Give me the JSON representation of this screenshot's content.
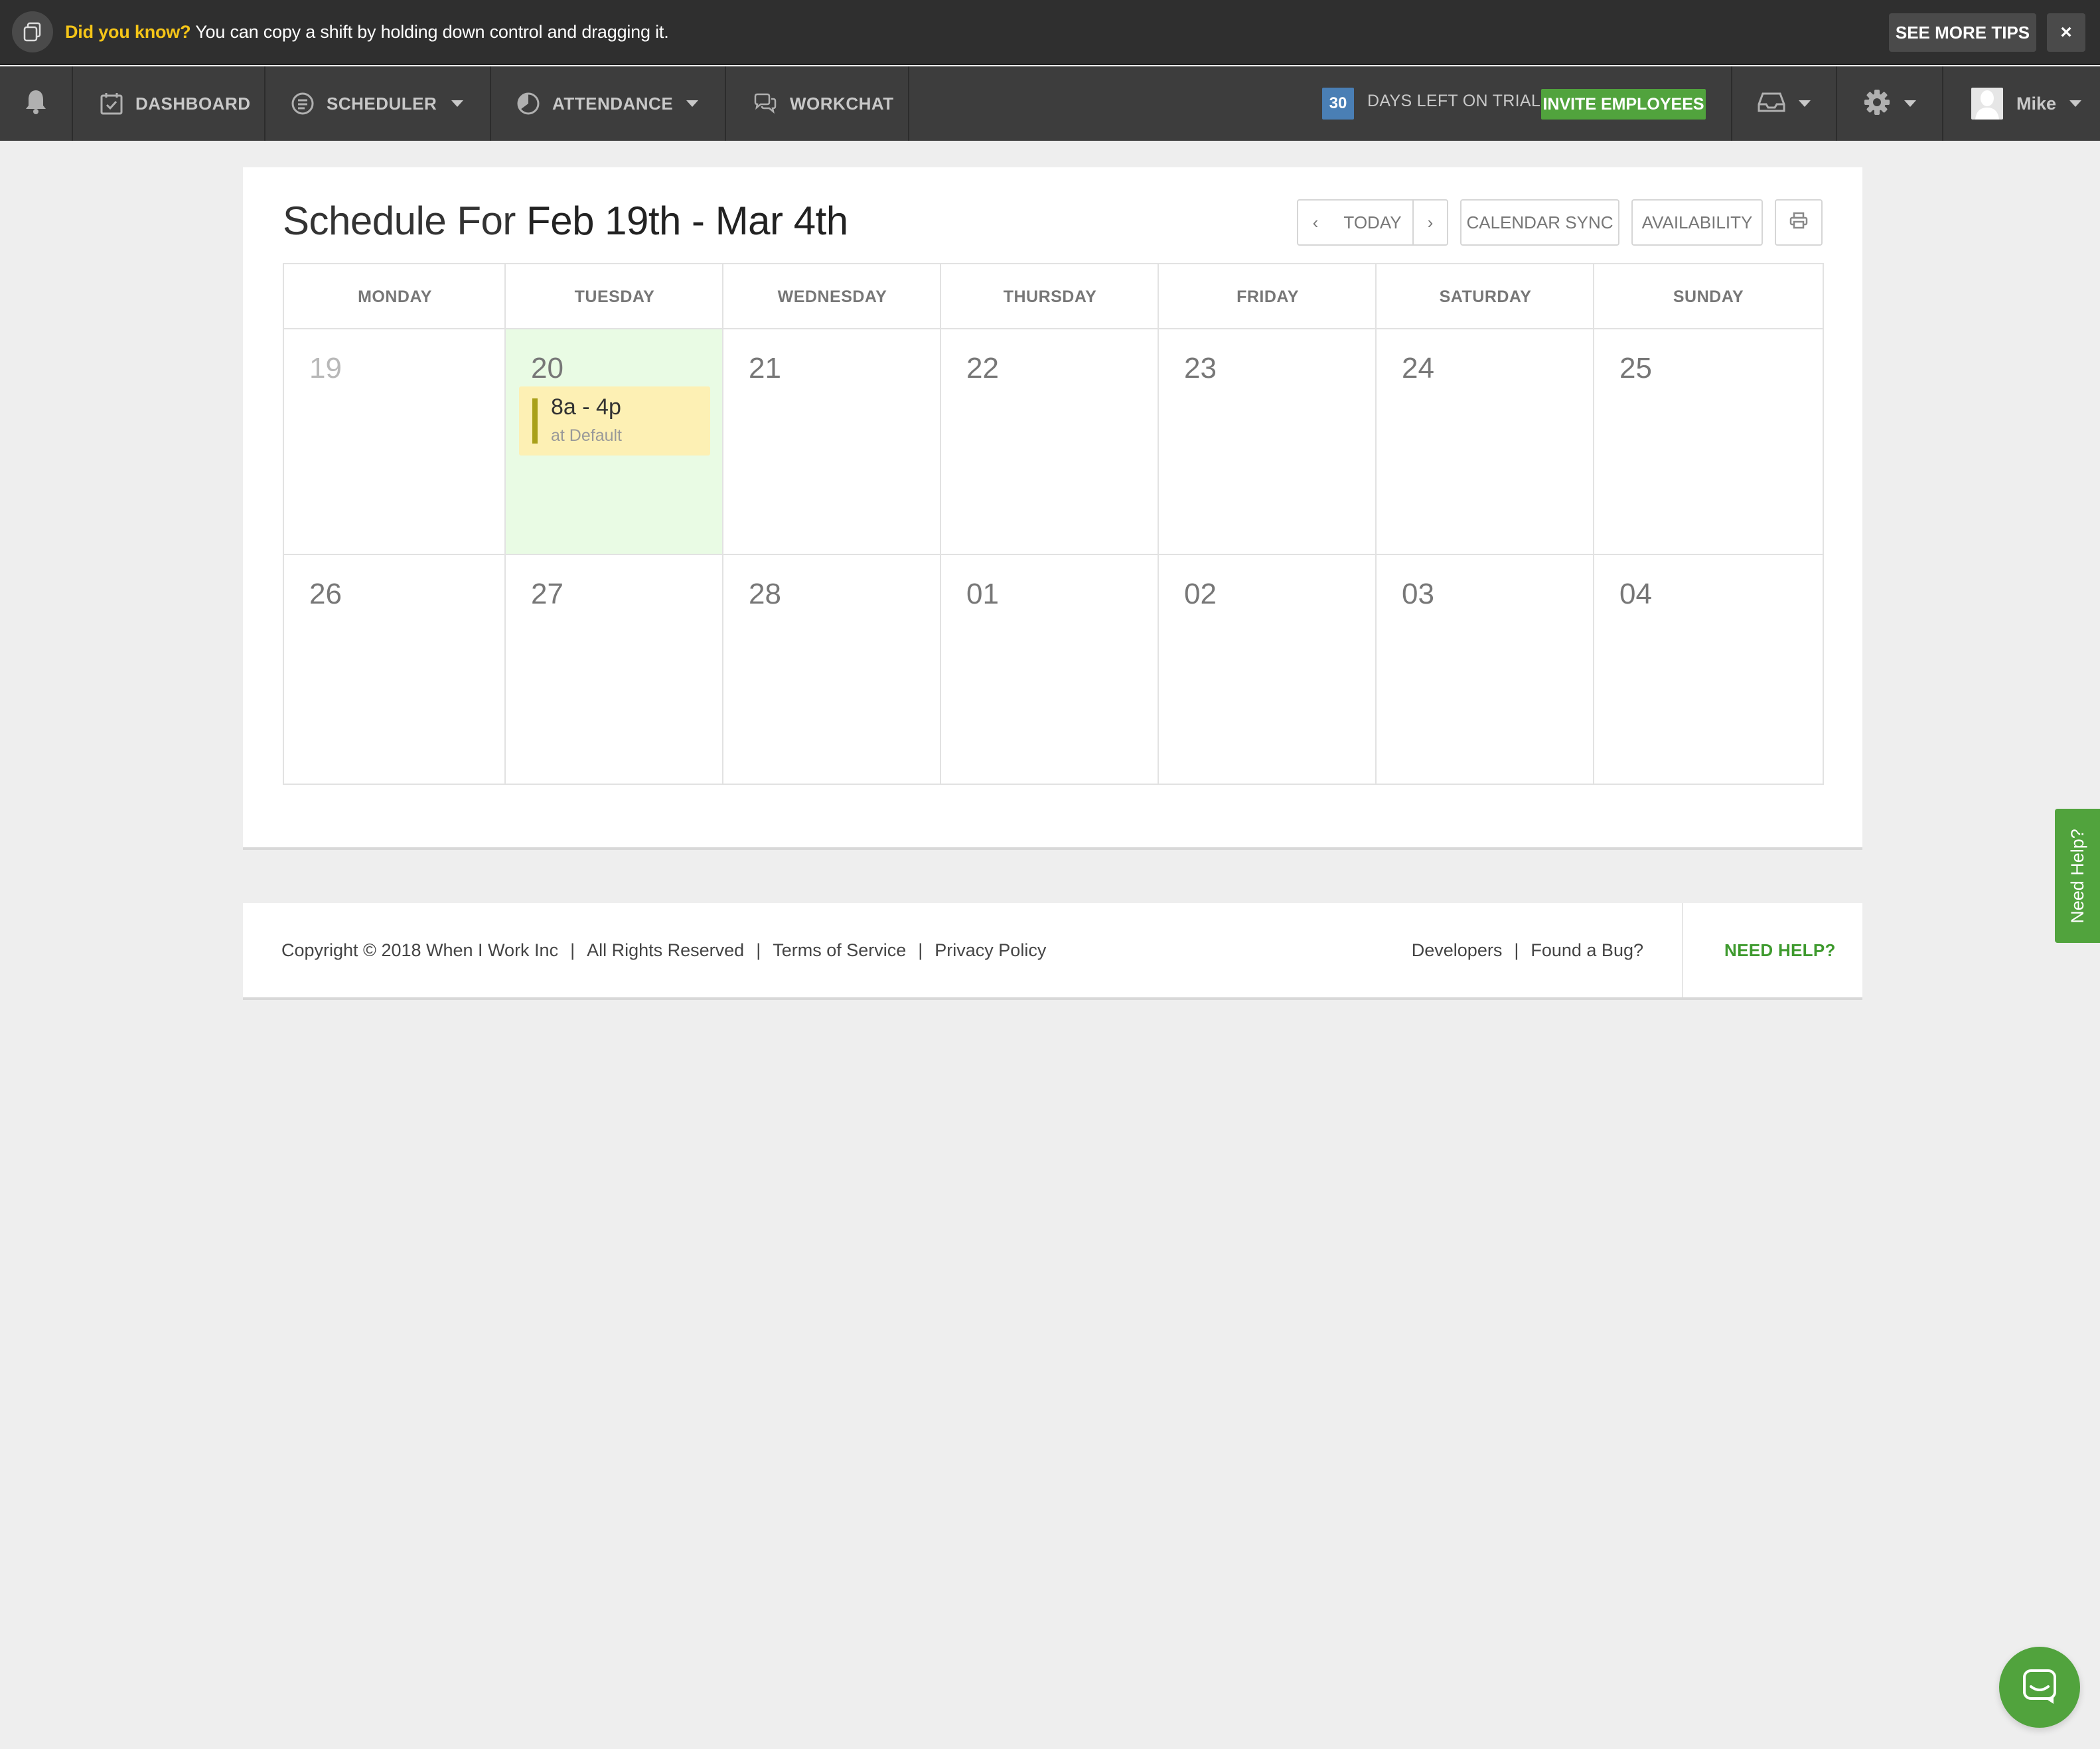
{
  "tipbar": {
    "highlight": "Did you know?",
    "message": " You can copy a shift by holding down control and dragging it.",
    "see_more": "SEE MORE TIPS",
    "close": "×"
  },
  "nav": {
    "dashboard": "DASHBOARD",
    "scheduler": "SCHEDULER",
    "attendance": "ATTENDANCE",
    "workchat": "WORKCHAT",
    "trial_days": "30",
    "trial_label": "DAYS LEFT ON TRIAL",
    "invite": "INVITE EMPLOYEES",
    "user_name": "Mike"
  },
  "schedule": {
    "title_prefix": "Schedule For ",
    "range": "Feb 19th - Mar 4th",
    "buttons": {
      "prev": "‹",
      "today": "TODAY",
      "next": "›",
      "calendar_sync": "CALENDAR SYNC",
      "availability": "AVAILABILITY"
    },
    "days": [
      "MONDAY",
      "TUESDAY",
      "WEDNESDAY",
      "THURSDAY",
      "FRIDAY",
      "SATURDAY",
      "SUNDAY"
    ],
    "week1": [
      "19",
      "20",
      "21",
      "22",
      "23",
      "24",
      "25"
    ],
    "week2": [
      "26",
      "27",
      "28",
      "01",
      "02",
      "03",
      "04"
    ],
    "shift": {
      "time": "8a - 4p",
      "location": "at Default"
    }
  },
  "footer": {
    "copyright": "Copyright © 2018 When I Work Inc",
    "rights": "All Rights Reserved",
    "terms": "Terms of Service",
    "privacy": "Privacy Policy",
    "developers": "Developers",
    "bug": "Found a Bug?",
    "need_help": "NEED HELP?"
  },
  "sidetab": {
    "label": "Need Help?"
  },
  "colors": {
    "accent_green": "#51a33d",
    "tip_highlight": "#f5c518",
    "trial_badge": "#4a7fb5",
    "today_bg": "#e9fbe4",
    "shift_bg": "#fdf0b4"
  }
}
